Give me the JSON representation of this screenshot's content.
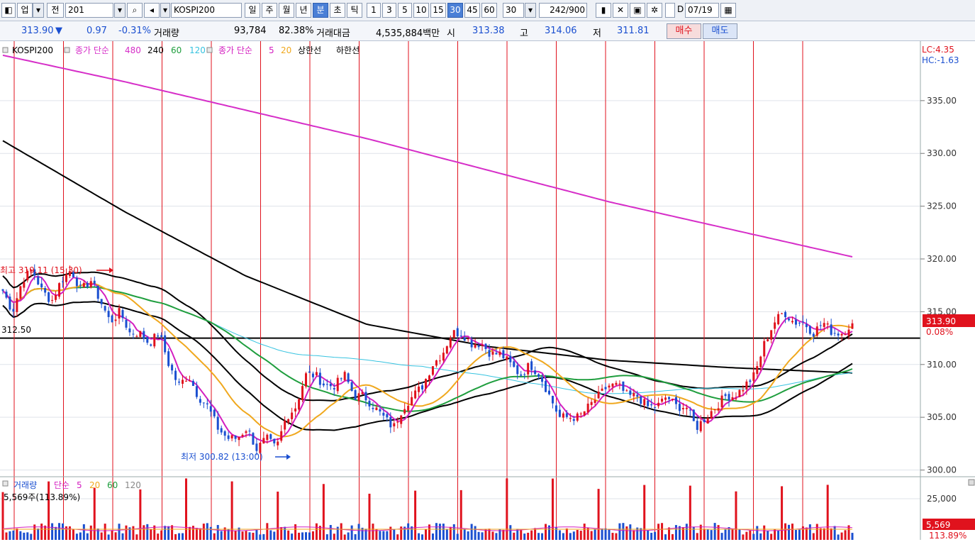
{
  "toolbar": {
    "market": "업",
    "prev": "전",
    "code": "201",
    "name": "KOSPI200",
    "periods": [
      "일",
      "주",
      "월",
      "년",
      "분",
      "초",
      "틱"
    ],
    "minutes": [
      "1",
      "3",
      "5",
      "10",
      "15",
      "30",
      "45",
      "60"
    ],
    "selected_minute": "30",
    "interval_value": "30",
    "count": "242",
    "count_total": "/900",
    "date": "07/19",
    "date_check": "D"
  },
  "quote": {
    "price": "313.90",
    "direction": "▼",
    "change": "0.97",
    "change_pct": "-0.31%",
    "volume_label": "거래량",
    "volume": "93,784",
    "volume_pct": "82.38%",
    "amount_label": "거래대금",
    "amount": "4,535,884백만",
    "open_label": "시",
    "open": "313.38",
    "high_label": "고",
    "high": "314.06",
    "low_label": "저",
    "low": "311.81",
    "buy_label": "매수",
    "sell_label": "매도"
  },
  "legend": {
    "symbol": "KOSPI200",
    "ma_long_label": "종가 단순",
    "ma_long": [
      "480",
      "240",
      "60",
      "120"
    ],
    "ma_short_label": "종가 단순",
    "ma_short": [
      "5",
      "20"
    ],
    "upper": "상한선",
    "lower": "하한선",
    "lc": "LC:4.35",
    "hc": "HC:-1.63"
  },
  "annotations": {
    "high": "최고 319.11 (15:30)",
    "low": "최저 300.82 (13:00)",
    "hline": "312.50",
    "last_price": "313.90",
    "last_pct": "0.08%"
  },
  "volume_panel": {
    "label": "거래량",
    "ma_label": "단순",
    "periods": [
      "5",
      "20",
      "60",
      "120"
    ],
    "current": "5,569주(113.89%)",
    "last": "5,569",
    "last_pct": "113.89%"
  },
  "colors": {
    "up": "#e0121d",
    "down": "#1a4fd0",
    "ma5": "#d41fc0",
    "ma20": "#f0a81e",
    "ma60": "#1f9e3e",
    "ma120": "#37c3e0",
    "ma480": "#d62ec8",
    "ma240": "#000000",
    "band": "#000000",
    "session_line": "#e0121d"
  },
  "chart_data": {
    "type": "candlestick",
    "title": "KOSPI200",
    "interval": "30분",
    "y_ticks": [
      "300.00",
      "305.00",
      "310.00",
      "315.00",
      "320.00",
      "325.00",
      "330.00",
      "335.00"
    ],
    "ylim": [
      299.5,
      340.3
    ],
    "candle_close_path": [
      317,
      315,
      318,
      319,
      317,
      316,
      318,
      319,
      317,
      318,
      316,
      314,
      315,
      313,
      313,
      312,
      313,
      310,
      308,
      309,
      307,
      306,
      304,
      303,
      303,
      304,
      302,
      303,
      302,
      305,
      306,
      309,
      309,
      308,
      308,
      309,
      307,
      307,
      306,
      305,
      304,
      306,
      307,
      308,
      310,
      311,
      313,
      313,
      312,
      312,
      311,
      311,
      310,
      309,
      310,
      309,
      307,
      305,
      305,
      305,
      306,
      307,
      308,
      308,
      307,
      307,
      306,
      306,
      307,
      306,
      306,
      304,
      305,
      306,
      307,
      307,
      308,
      309,
      312,
      314,
      315,
      314,
      314,
      313,
      314,
      313,
      313,
      314
    ],
    "ma480": [
      339.3,
      336.8,
      334.1,
      331.4,
      328.4,
      325.4,
      322.8,
      320.2
    ],
    "ma240": [
      331.2,
      324.5,
      318.4,
      313.8,
      311.7,
      310.4,
      309.7,
      309.2
    ],
    "volume_ticks": [
      "25,000"
    ],
    "volume_last": 5569,
    "price_last": 313.9,
    "hline": 312.5
  }
}
